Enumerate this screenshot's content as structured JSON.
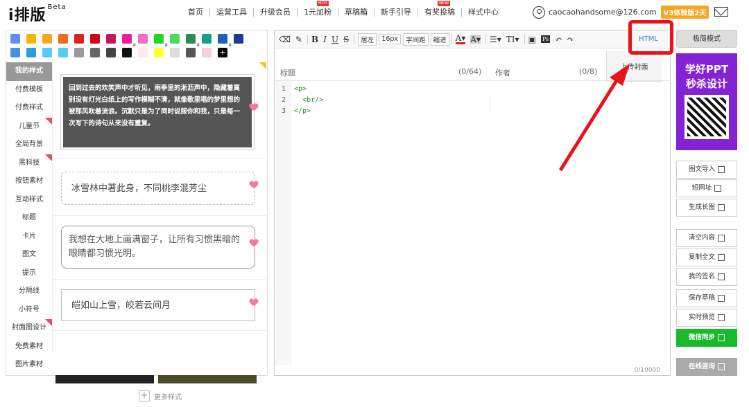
{
  "brand": {
    "name": "i排版",
    "beta": "Beta"
  },
  "nav": [
    {
      "label": "首页",
      "badge": ""
    },
    {
      "label": "运营工具",
      "badge": ""
    },
    {
      "label": "升级会员",
      "badge": ""
    },
    {
      "label": "1元加粉",
      "badge": "HOT"
    },
    {
      "label": "草稿箱",
      "badge": ""
    },
    {
      "label": "新手引导",
      "badge": ""
    },
    {
      "label": "有奖投稿",
      "badge": "NEW"
    },
    {
      "label": "样式中心",
      "badge": ""
    }
  ],
  "user": {
    "email": "caocaohandsome@126.com",
    "trial": "V3体验版2天"
  },
  "colors": [
    "#5b8ff9",
    "#f7b500",
    "#f5a623",
    "#f26b1d",
    "#e02020",
    "#d0021b",
    "#c2185b",
    "#e91e9a",
    "#f06ec6",
    "#21d921",
    "#4cd964",
    "#2e8b57",
    "#16a085",
    "#1f5fbf",
    "#1d3c8f",
    "#4a90e2",
    "#2d9cdb",
    "#5ac8fa",
    "#56ccf2",
    "#999999",
    "#666666",
    "#444444",
    "#111111",
    "#fde9ef",
    "#ffff33",
    "#dddddd",
    "#555555",
    "#f5d0d6",
    "#000000"
  ],
  "color_x_marks": [
    7,
    9,
    11,
    13
  ],
  "categories": [
    {
      "label": "我的样式",
      "active": true,
      "flag": false
    },
    {
      "label": "付费模板",
      "active": false,
      "flag": false
    },
    {
      "label": "付费样式",
      "active": false,
      "flag": false
    },
    {
      "label": "儿童节",
      "active": false,
      "flag": true
    },
    {
      "label": "全局背景",
      "active": false,
      "flag": false
    },
    {
      "label": "黑科技",
      "active": false,
      "flag": true
    },
    {
      "label": "按钮素材",
      "active": false,
      "flag": false
    },
    {
      "label": "互动样式",
      "active": false,
      "flag": false
    },
    {
      "label": "标题",
      "active": false,
      "flag": false
    },
    {
      "label": "卡片",
      "active": false,
      "flag": false
    },
    {
      "label": "图文",
      "active": false,
      "flag": false
    },
    {
      "label": "提示",
      "active": false,
      "flag": false
    },
    {
      "label": "分隔线",
      "active": false,
      "flag": false
    },
    {
      "label": "小符号",
      "active": false,
      "flag": false
    },
    {
      "label": "封面图设计",
      "active": false,
      "flag": true
    },
    {
      "label": "免费素材",
      "active": false,
      "flag": false
    },
    {
      "label": "图片素材",
      "active": false,
      "flag": false
    }
  ],
  "style_samples": {
    "dark_text": "回到过去的欢笑声中才听见，雨季里的淅沥声中，隐藏着离别没有灯光白纸上的写作模糊不清，就像歌里唱的梦里想的被那风吹着流浪。沉默只是为了同时说服你和我，只是每一次写下的诗句从来没有重复。",
    "text2": "冰雪林中著此身，不同桃李混芳尘",
    "text3": "我想在大地上画满窗子，让所有习惯黑暗的眼睛都习惯光明。",
    "text4": "皑如山上雪，皎若云间月",
    "more": "更多样式"
  },
  "toolbar": {
    "align": "居左",
    "fontsize": "16px",
    "letter_spacing": "字间距",
    "indent": "缩进",
    "html": "HTML"
  },
  "editor": {
    "title_label": "标题",
    "title_count": "(0/64)",
    "author_label": "作者",
    "author_count": "(0/8)",
    "cover": "上传封面",
    "lines": [
      "<p>",
      "  <br/>",
      "</p>"
    ],
    "word_count": "0/10000"
  },
  "right": {
    "simple_mode": "极简模式",
    "ad_line1": "学好PPT",
    "ad_line2": "秒杀设计",
    "buttons": [
      "图文导入",
      "短网址",
      "生成长图",
      "清空内容",
      "复制全文",
      "我的签名",
      "保存草稿",
      "实时预览",
      "微信同步",
      "在线咨询"
    ]
  }
}
